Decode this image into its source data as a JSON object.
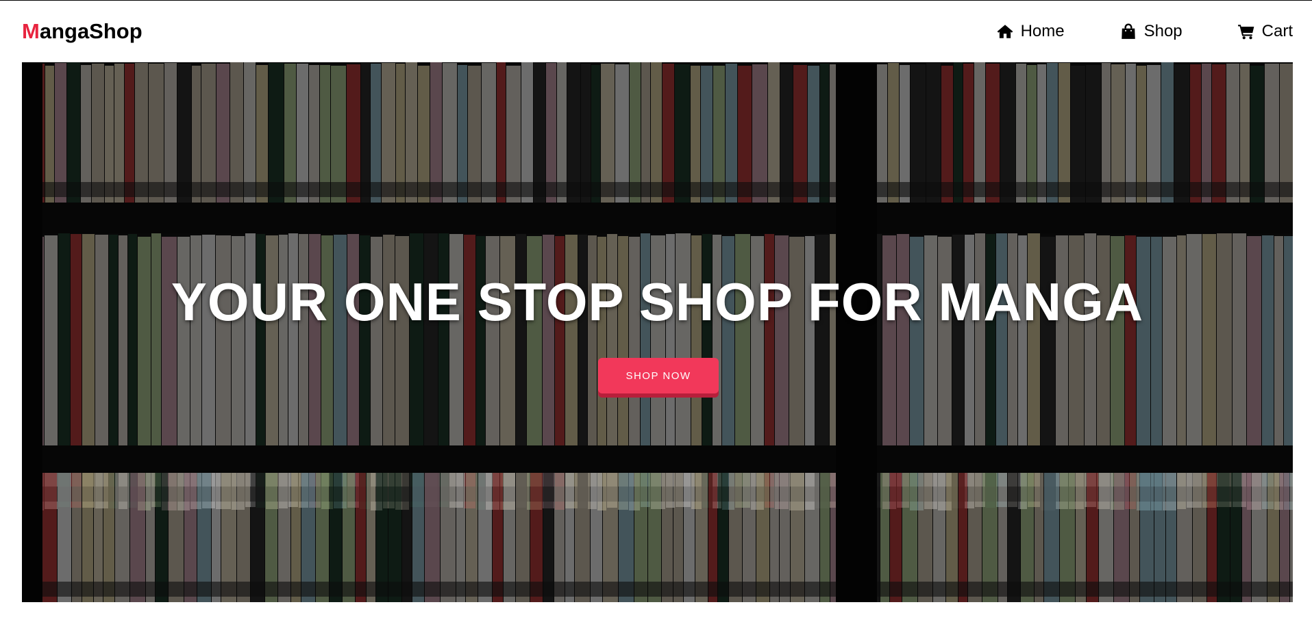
{
  "brand": {
    "first_letter": "M",
    "rest": "angaShop",
    "accent": "#e8243f"
  },
  "nav": {
    "home": {
      "label": "Home",
      "icon": "home-icon"
    },
    "shop": {
      "label": "Shop",
      "icon": "shopping-bag-icon"
    },
    "cart": {
      "label": "Cart",
      "icon": "shopping-cart-icon"
    }
  },
  "hero": {
    "headline": "YOUR ONE STOP SHOP FOR MANGA",
    "cta_label": "SHOP NOW",
    "cta_color": "#f2385a"
  }
}
